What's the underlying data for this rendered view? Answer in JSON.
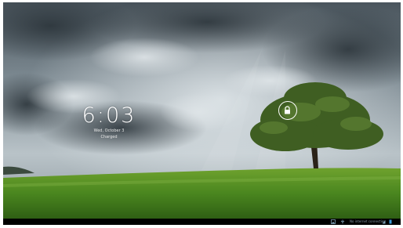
{
  "lockscreen": {
    "time": "6:03",
    "date": "Wed, October 3",
    "charging_status": "Charged"
  },
  "status_bar": {
    "network_text": "No internet connection",
    "icons": [
      "photo-icon",
      "usb-icon",
      "wifi-signal-icon",
      "battery-icon"
    ]
  },
  "colors": {
    "sky_dark": "#3f4a52",
    "sky_light": "#c9d1d6",
    "grass": "#4f8a23",
    "tree": "#3d5a21",
    "status_bar": "#000000"
  }
}
